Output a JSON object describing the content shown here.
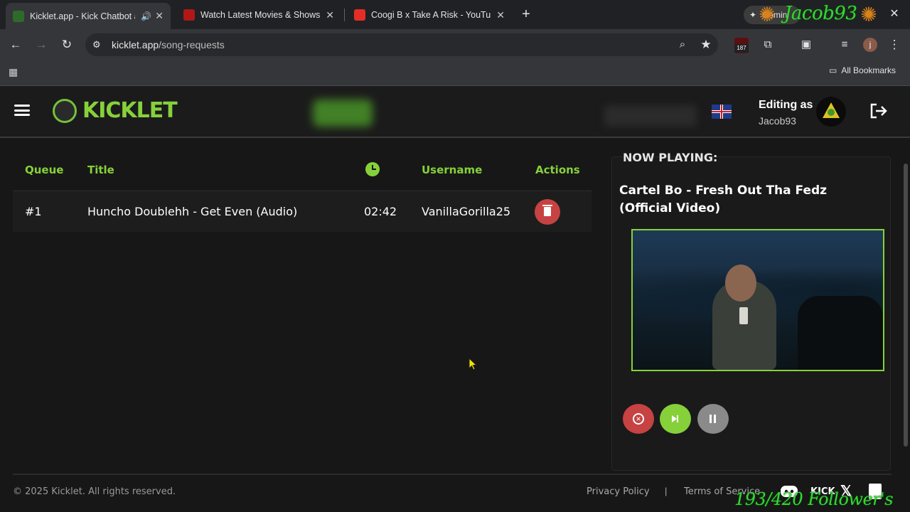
{
  "browser": {
    "tabs": [
      {
        "title": "Kicklet.app - Kick Chatbot a",
        "active": true
      },
      {
        "title": "Watch Latest Movies & Shows i",
        "active": false
      },
      {
        "title": "Coogi B x Take A Risk - YouTube",
        "active": false
      }
    ],
    "gemini_label": "Gemini",
    "url_host": "kicklet.app",
    "url_path": "/song-requests",
    "extension_badge": "187",
    "profile_initial": "j",
    "bookmarks_label": "All Bookmarks"
  },
  "header": {
    "logo": "KICKLET",
    "editing_label": "Editing as",
    "username": "Jacob93",
    "language_flag": "uk-flag-icon"
  },
  "queue": {
    "columns": {
      "queue": "Queue",
      "title": "Title",
      "duration_icon": "clock-icon",
      "username": "Username",
      "actions": "Actions"
    },
    "rows": [
      {
        "position": "#1",
        "title": "Huncho Doublehh - Get Even (Audio)",
        "duration": "02:42",
        "username": "VanillaGorilla25"
      }
    ]
  },
  "now_playing": {
    "label": "NOW PLAYING:",
    "title": "Cartel Bo - Fresh Out Tha Fedz (Official Video)"
  },
  "footer": {
    "copyright": "© 2025 Kicklet. All rights reserved.",
    "privacy": "Privacy Policy",
    "separator": "|",
    "terms": "Terms of Service",
    "social_kick": "KICK"
  },
  "overlay": {
    "name": "Jacob93",
    "followers": "193/420 Follower's"
  },
  "colors": {
    "accent": "#86d13a",
    "danger": "#c74242",
    "neutral": "#8a8a8a",
    "background": "#171717"
  }
}
